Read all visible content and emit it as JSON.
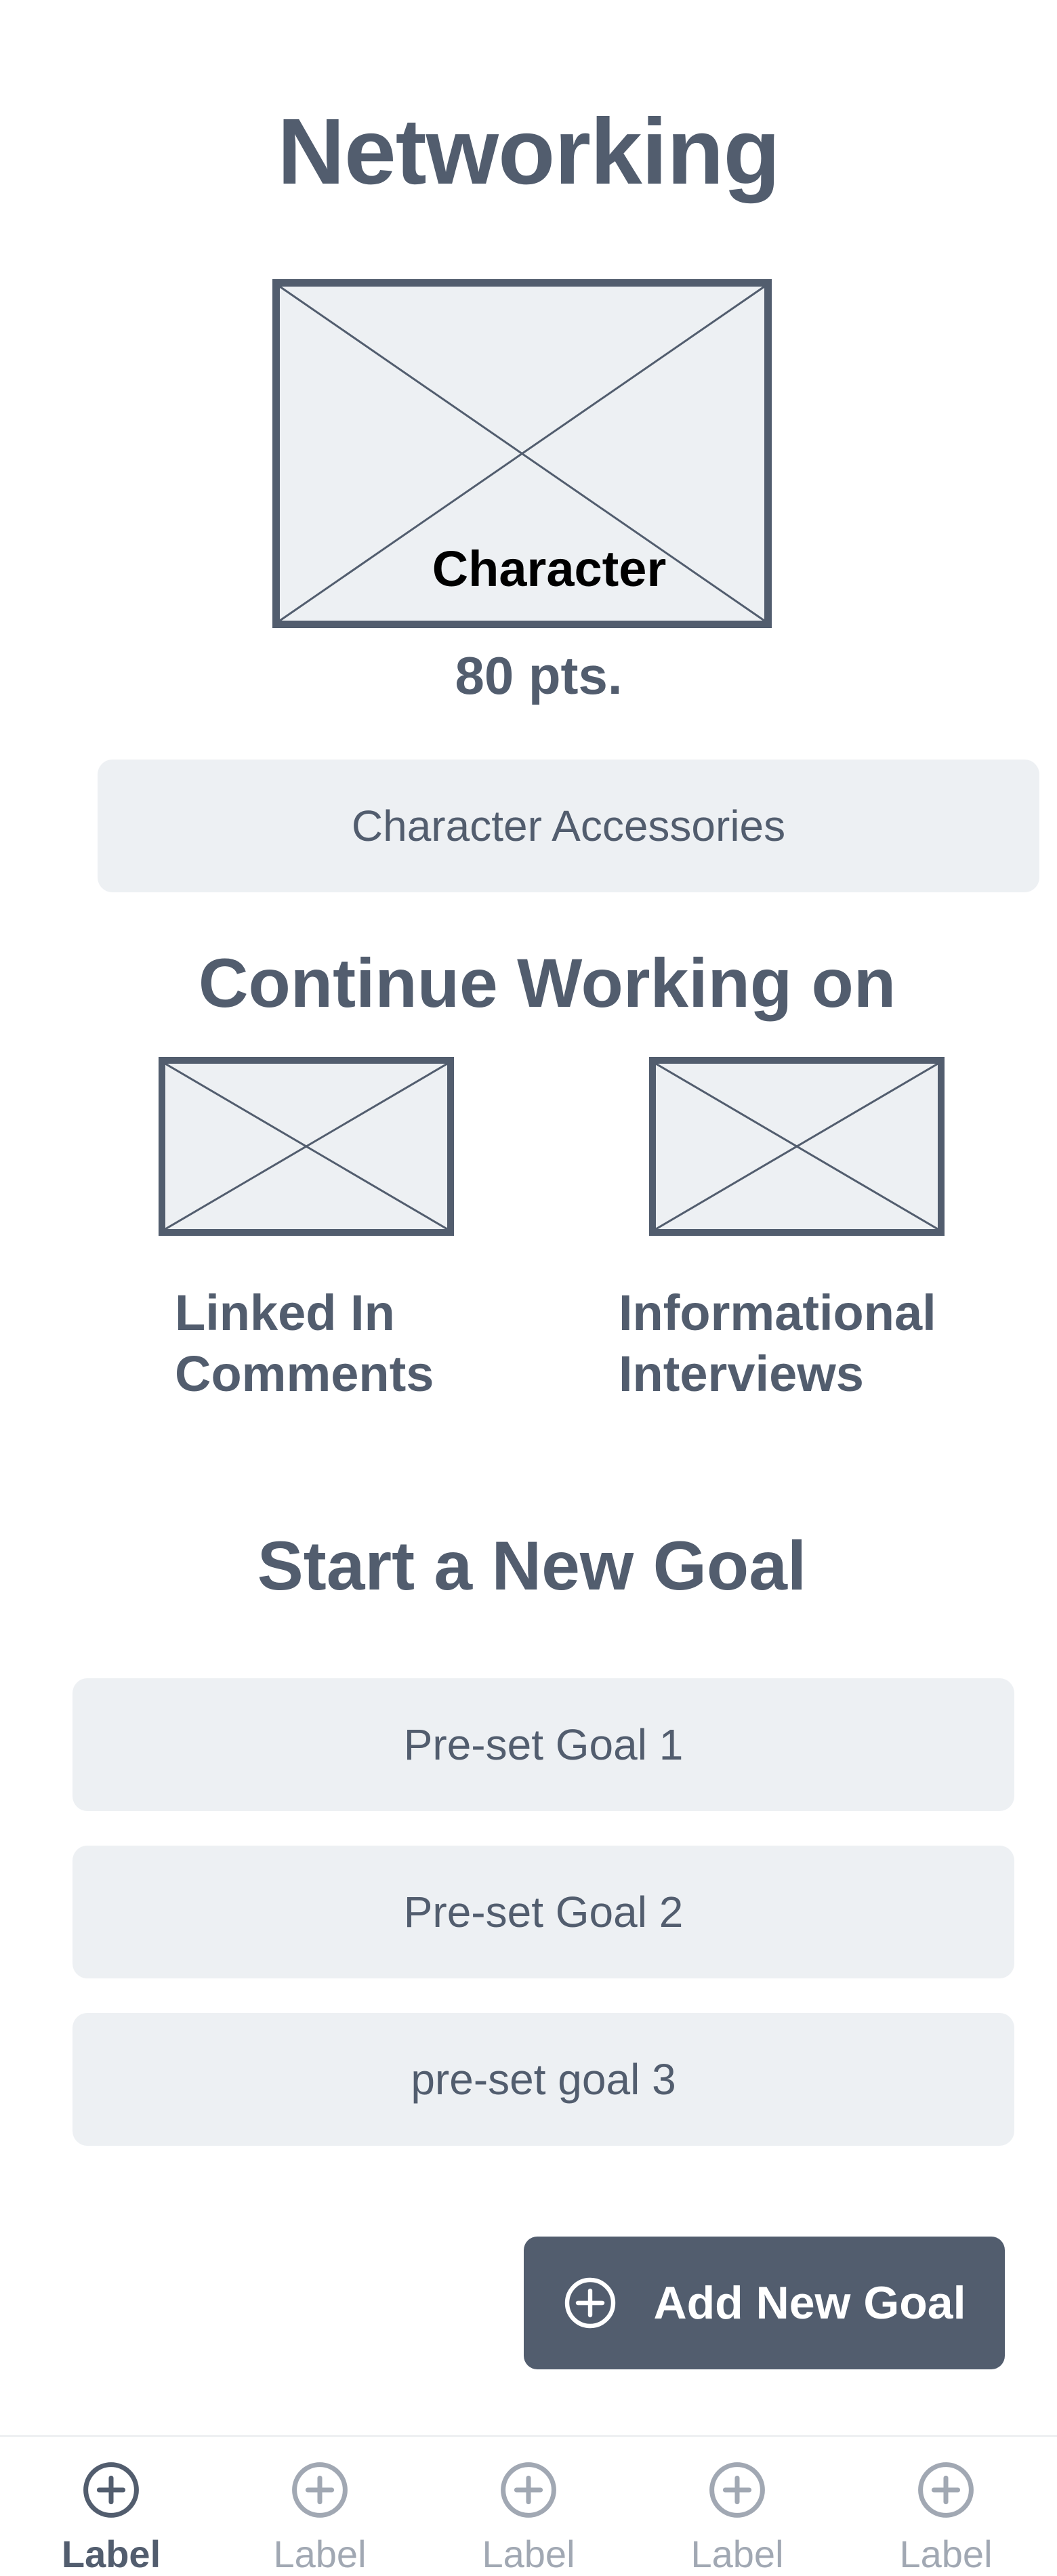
{
  "page": {
    "title": "Networking",
    "character": {
      "label": "Character",
      "points": "80 pts."
    },
    "accessories_button": "Character Accessories"
  },
  "continue_section": {
    "title": "Continue Working on",
    "cards": [
      {
        "label": "Linked In Comments"
      },
      {
        "label": "Informational Interviews"
      }
    ]
  },
  "goal_section": {
    "title": "Start a New Goal",
    "goals": [
      "Pre-set Goal 1",
      "Pre-set Goal 2",
      "pre-set goal 3"
    ],
    "add_button": "Add New Goal",
    "add_icon": "plus-circle-icon"
  },
  "tabbar": {
    "active_index": 0,
    "tabs": [
      {
        "label": "Label",
        "icon": "plus-circle-icon"
      },
      {
        "label": "Label",
        "icon": "plus-circle-icon"
      },
      {
        "label": "Label",
        "icon": "plus-circle-icon"
      },
      {
        "label": "Label",
        "icon": "plus-circle-icon"
      },
      {
        "label": "Label",
        "icon": "plus-circle-icon"
      }
    ]
  },
  "colors": {
    "primary": "#525d6e",
    "placeholder_bg": "#edf0f3",
    "inactive": "#a1a8b3",
    "background": "#ffffff"
  }
}
